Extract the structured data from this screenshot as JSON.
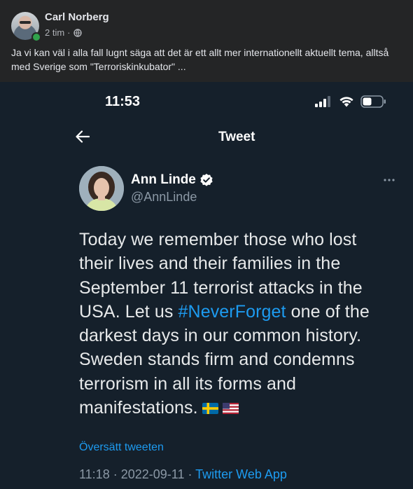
{
  "post": {
    "author_name": "Carl Norberg",
    "time": "2 tim",
    "separator": "·",
    "text_line1": "Ja vi kan väl i alla fall lugnt säga att det är ett allt mer internationellt aktuellt tema, alltså",
    "text_line2": "med Sverige som \"Terroriskinkubator\" ..."
  },
  "phone": {
    "status_bar": {
      "time": "11:53"
    },
    "header": {
      "title": "Tweet"
    },
    "tweet": {
      "author_name": "Ann Linde",
      "handle": "@AnnLinde",
      "body_lines": [
        "Today we remember those who lost",
        "their lives and their families in the",
        "September 11 terrorist attacks in the"
      ],
      "line4_before": "USA. Let us ",
      "hashtag": "#NeverForget",
      "line4_after": " one of the",
      "body_lines_after": [
        "darkest days in our common history.",
        "Sweden stands firm and condemns",
        "terrorism in all its forms and"
      ],
      "last_line": "manifestations.",
      "translate_label": "Översätt tweeten",
      "time": "11:18",
      "date": "2022-09-11",
      "meta_separator": " · ",
      "source_app": "Twitter Web App"
    }
  },
  "colors": {
    "facebook_bg": "#242526",
    "twitter_bg": "#15202b",
    "twitter_blue": "#1d9bf0",
    "secondary_text": "#8b98a5"
  },
  "icons": [
    "globe-icon",
    "signal-icon",
    "wifi-icon",
    "battery-icon",
    "back-arrow-icon",
    "verified-badge-icon",
    "more-options-icon",
    "swedish-flag-emoji",
    "us-flag-emoji"
  ]
}
